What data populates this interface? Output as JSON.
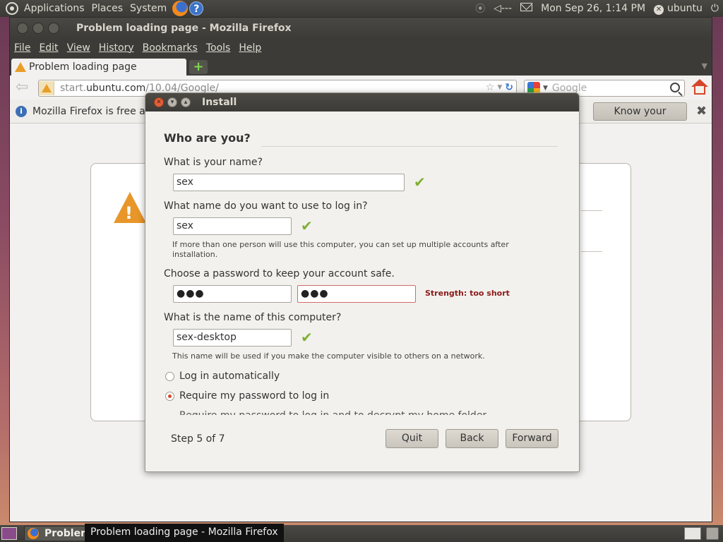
{
  "top_panel": {
    "menus": [
      "Applications",
      "Places",
      "System"
    ],
    "datetime": "Mon Sep 26,  1:14 PM",
    "user": "ubuntu",
    "volume_text": "◁---"
  },
  "firefox": {
    "window_title": "Problem loading page - Mozilla Firefox",
    "menu": [
      "File",
      "Edit",
      "View",
      "History",
      "Bookmarks",
      "Tools",
      "Help"
    ],
    "tab_title": "Problem loading page",
    "url_prefix": "start.",
    "url_host": "ubuntu.com",
    "url_path": "/10.04/Google/",
    "search_placeholder": "Google",
    "notice_text": "Mozilla Firefox is free an",
    "notice_button": "Know your rights..."
  },
  "installer": {
    "title": "Install",
    "heading": "Who are you?",
    "name_question": "What is your name?",
    "name_value": "sex",
    "login_question": "What name do you want to use to log in?",
    "login_value": "sex",
    "login_hint": "If more than one person will use this computer, you can set up multiple accounts after installation.",
    "password_question": "Choose a password to keep your account safe.",
    "password_value": "●●●",
    "confirm_value": "●●●",
    "strength": "Strength: too short",
    "computer_question": "What is the name of this computer?",
    "computer_value": "sex-desktop",
    "computer_hint": "This name will be used if you make the computer visible to others on a network.",
    "options": [
      {
        "label": "Log in automatically",
        "selected": false
      },
      {
        "label": "Require my password to log in",
        "selected": true
      },
      {
        "label": "Require my password to log in and to decrypt my home folder",
        "selected": false
      }
    ],
    "step": "Step 5 of 7",
    "buttons": {
      "quit": "Quit",
      "back": "Back",
      "forward": "Forward"
    }
  },
  "taskbar": {
    "task_label": "Probler",
    "tooltip": "Problem loading page - Mozilla Firefox"
  }
}
